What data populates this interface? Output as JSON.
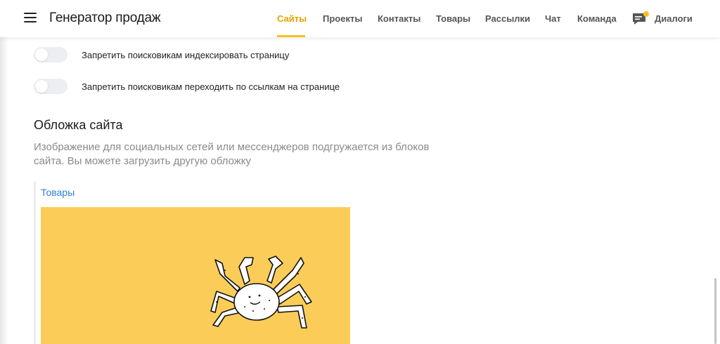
{
  "header": {
    "title": "Генератор продаж",
    "nav": [
      {
        "label": "Сайты",
        "active": true
      },
      {
        "label": "Проекты"
      },
      {
        "label": "Контакты"
      },
      {
        "label": "Товары"
      },
      {
        "label": "Рассылки"
      },
      {
        "label": "Чат"
      },
      {
        "label": "Команда"
      }
    ],
    "dialogs_label": "Диалоги"
  },
  "settings": {
    "toggle_no_index": "Запретить поисковикам индексировать страницу",
    "toggle_no_follow": "Запретить поисковикам переходить по ссылкам на странице"
  },
  "cover": {
    "title": "Обложка сайта",
    "description": "Изображение для социальных сетей или мессенджеров подгружается из блоков сайта. Вы можете загрузить другую обложку",
    "preview_link": "Товары"
  },
  "colors": {
    "accent": "#f4c21f",
    "active_nav": "#e7a300",
    "link": "#2f7fd1",
    "cover_bg": "#fbcd58"
  },
  "icons": {
    "menu": "hamburger-icon",
    "dialogs": "chat-bubble-icon",
    "cover": "crab-illustration"
  }
}
